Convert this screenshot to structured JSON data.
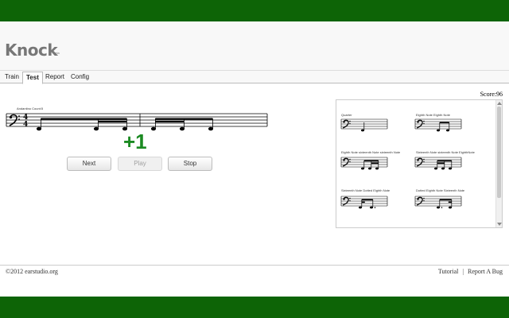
{
  "app": {
    "name": "Knock",
    "badge": "beta"
  },
  "tabs": [
    {
      "label": "Train",
      "active": false
    },
    {
      "label": "Test",
      "active": true
    },
    {
      "label": "Report",
      "active": false
    },
    {
      "label": "Config",
      "active": false
    }
  ],
  "score": {
    "label": "Score:96"
  },
  "exercise": {
    "title": "Andantino Count:5",
    "time_signature_top": "4",
    "time_signature_bottom": "4",
    "feedback": "+1"
  },
  "buttons": {
    "next": "Next",
    "play": "Play",
    "stop": "Stop"
  },
  "rhythm_panel": {
    "items": [
      {
        "label": "Quarter"
      },
      {
        "label": "Eighth Note Eighth Note"
      },
      {
        "label": "Eighth Note sixteenth Note sixteenth Note"
      },
      {
        "label": "Sixteenth Note sixteenth Note EighthNote"
      },
      {
        "label": "Sixteenth Note Dotted Eighth Note"
      },
      {
        "label": "Dotted Eighth Note Sixteenth Note"
      }
    ]
  },
  "footer": {
    "copyright": "©2012 earstudio.org",
    "tutorial": "Tutorial",
    "separator": "|",
    "report_bug": "Report A Bug"
  },
  "colors": {
    "brand_green": "#0d6406",
    "feedback_green": "#1b8a22"
  }
}
